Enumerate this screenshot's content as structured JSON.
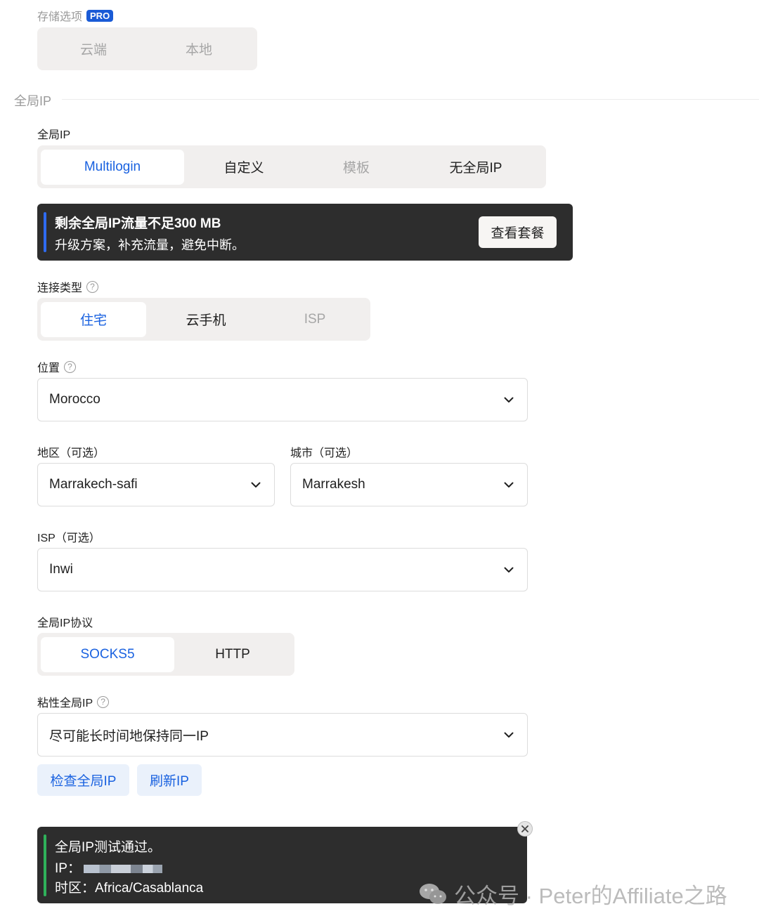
{
  "storage": {
    "label": "存储选项",
    "badge": "PRO",
    "options": [
      "云端",
      "本地"
    ]
  },
  "section": {
    "title": "全局IP"
  },
  "global_ip": {
    "label": "全局IP",
    "tabs": [
      "Multilogin",
      "自定义",
      "模板",
      "无全局IP"
    ],
    "active": "Multilogin",
    "disabled": "模板"
  },
  "banner": {
    "title": "剩余全局IP流量不足300 MB",
    "subtitle": "升级方案，补充流量，避免中断。",
    "button": "查看套餐"
  },
  "connection_type": {
    "label": "连接类型",
    "tabs": [
      "住宅",
      "云手机",
      "ISP"
    ],
    "active": "住宅",
    "disabled": "ISP"
  },
  "location": {
    "label": "位置",
    "value": "Morocco"
  },
  "region": {
    "label": "地区（可选）",
    "value": "Marrakech-safi"
  },
  "city": {
    "label": "城市（可选）",
    "value": "Marrakesh"
  },
  "isp": {
    "label": "ISP（可选）",
    "value": "Inwi"
  },
  "protocol": {
    "label": "全局IP协议",
    "tabs": [
      "SOCKS5",
      "HTTP"
    ],
    "active": "SOCKS5"
  },
  "sticky": {
    "label": "粘性全局IP",
    "value": "尽可能长时间地保持同一IP"
  },
  "actions": {
    "check": "检查全局IP",
    "refresh": "刷新IP"
  },
  "toast": {
    "line1": "全局IP测试通过。",
    "ip_label": "IP：",
    "tz_label": "时区：",
    "tz_value": "Africa/Casablanca"
  },
  "watermark": {
    "text": "公众号 · Peter的Affiliate之路"
  },
  "colors": {
    "accent": "#1a62e0",
    "banner_bg": "#2d2d2d",
    "success": "#2fb15a",
    "segment_bg": "#f1efee"
  }
}
